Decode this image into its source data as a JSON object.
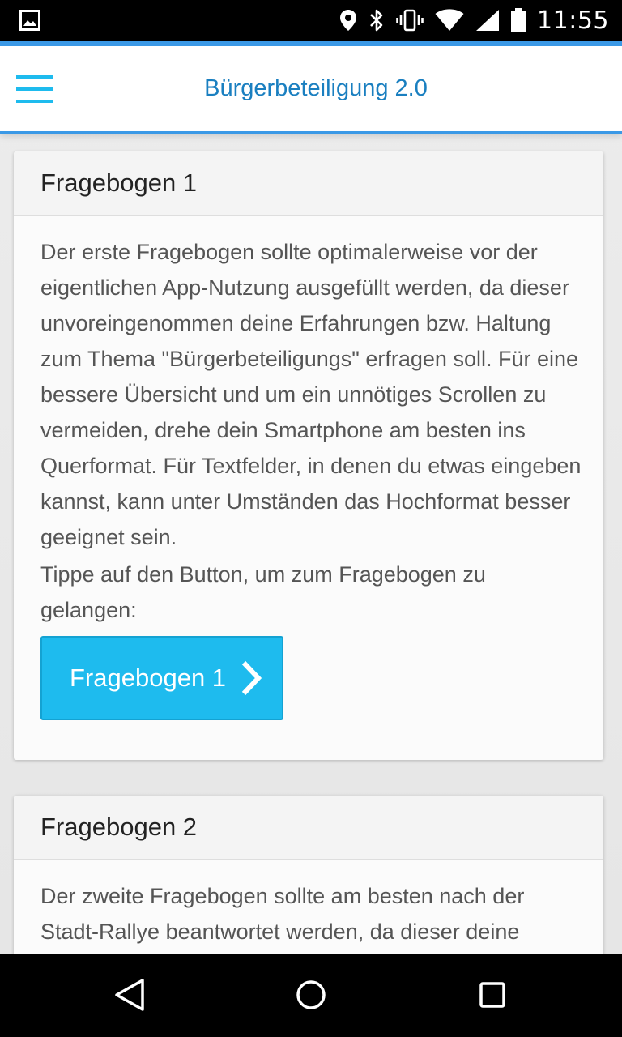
{
  "status_bar": {
    "time": "11:55",
    "icons": [
      "image-icon",
      "location-icon",
      "bluetooth-icon",
      "vibrate-icon",
      "wifi-icon",
      "signal-icon",
      "battery-icon"
    ]
  },
  "app_bar": {
    "title": "Bürgerbeteiligung 2.0",
    "menu_icon": "hamburger-menu-icon",
    "accent_color": "#3b99e6",
    "title_color": "#1a7fc0"
  },
  "cards": [
    {
      "title": "Fragebogen 1",
      "paragraph_1": "Der erste Fragebogen sollte optimalerweise vor der eigentlichen App-Nutzung ausgefüllt werden, da dieser unvoreingenommen deine Erfahrungen bzw. Haltung zum Thema \"Bürgerbeteiligungs\" erfragen soll. Für eine bessere Übersicht und um ein unnötiges Scrollen zu vermeiden, drehe dein Smartphone am besten ins Querformat. Für Textfelder, in denen du etwas eingeben kannst, kann unter Umständen das Hochformat besser geeignet sein.",
      "paragraph_2": "Tippe auf den Button, um zum Fragebogen zu gelangen:",
      "button_label": "Fragebogen 1",
      "button_color": "#1ebbee"
    },
    {
      "title": "Fragebogen 2",
      "paragraph_1": "Der zweite Fragebogen sollte am besten nach der Stadt-Rallye beantwortet werden, da dieser deine"
    }
  ],
  "nav_bar": {
    "icons": [
      "back-icon",
      "home-icon",
      "recent-apps-icon"
    ]
  }
}
